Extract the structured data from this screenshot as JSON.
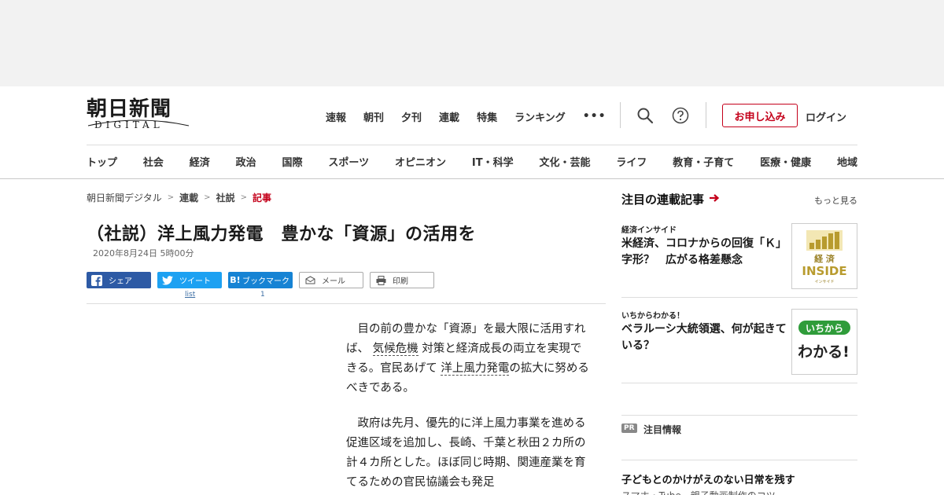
{
  "header": {
    "logo_main": "朝日新聞",
    "logo_sub": "DIGITAL",
    "top_nav": [
      "速報",
      "朝刊",
      "夕刊",
      "連載",
      "特集",
      "ランキング"
    ],
    "more_label": "•••",
    "apply_label": "お申し込み",
    "login_label": "ログイン",
    "categories": [
      "トップ",
      "社会",
      "経済",
      "政治",
      "国際",
      "スポーツ",
      "オピニオン",
      "IT・科学",
      "文化・芸能",
      "ライフ",
      "教育・子育て",
      "医療・健康",
      "地域"
    ]
  },
  "breadcrumb": [
    "朝日新聞デジタル",
    "連載",
    "社説",
    "記事"
  ],
  "article": {
    "title": "（社説）洋上風力発電　豊かな「資源」の活用を",
    "date": "2020年8月24日 5時00分",
    "share": {
      "facebook": "シェア",
      "twitter": "ツイート",
      "twitter_count": "list",
      "hatena_icon": "B!",
      "hatena": "ブックマーク",
      "hatena_count": "1",
      "mail": "メール",
      "print": "印刷"
    },
    "p1_a": "目の前の豊かな「資源」を最大限に活用すれば、",
    "p1_link1": "気候危機",
    "p1_b": "対策と経済成長の両立を実現できる。官民あげて",
    "p1_link2": "洋上風力発電",
    "p1_c": "の拡大に努めるべきである。",
    "p2": "政府は先月、優先的に洋上風力事業を進める促進区域を追加し、長崎、千葉と秋田２カ所の計４カ所とした。ほぼ同じ時期、関連産業を育てるための官民協議会も発足"
  },
  "sidebar": {
    "title": "注目の連載記事",
    "more": "もっと見る",
    "items": [
      {
        "series": "経済インサイド",
        "headline": "米経済、コロナからの回復「Ｋ」字形？　広がる格差懸念",
        "thumb_text1": "経 済",
        "thumb_text2": "INSIDE",
        "thumb_text3": "インサイド"
      },
      {
        "series": "いちからわかる！",
        "headline": "ベラルーシ大統領選、何が起きている？",
        "thumb_text1": "いちから",
        "thumb_text2": "わかる!"
      }
    ],
    "pr_tag": "PR",
    "pr_title": "注目情報",
    "pr_headline": "子どもとのかけがえのない日常を残す",
    "pr_sub": "スマホ・Tube、親子動画制作のコツ"
  },
  "colors": {
    "accent": "#c4001a",
    "facebook": "#2d5aa5",
    "twitter": "#1da1f2",
    "hatena": "#1683d4",
    "insight_gold": "#b89b2e",
    "ichikara_green": "#2f9c3a"
  }
}
